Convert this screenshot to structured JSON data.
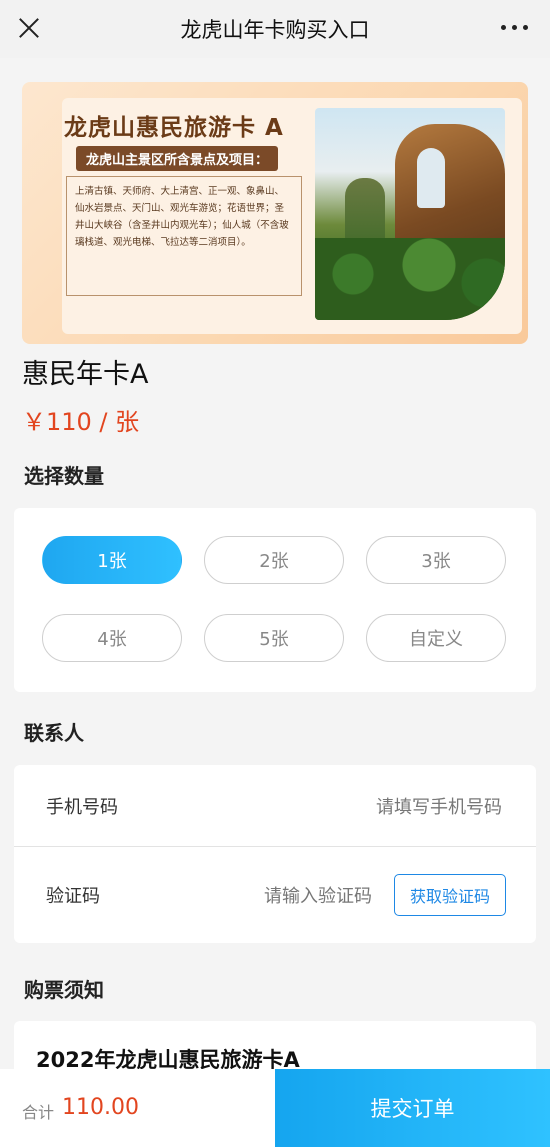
{
  "nav": {
    "title": "龙虎山年卡购买入口"
  },
  "banner": {
    "title": "龙虎山惠民旅游卡 A",
    "subtitle": "龙虎山主景区所含景点及项目：",
    "description": "上清古镇、天师府、大上清宫、正一观、象鼻山、仙水岩景点、天门山、观光车游览；花语世界；圣井山大峡谷（含圣井山内观光车）；仙人城（不含玻璃栈道、观光电梯、飞拉达等二消项目）。"
  },
  "product": {
    "name": "惠民年卡A",
    "price": "￥110 / 张"
  },
  "quantity": {
    "section_title": "选择数量",
    "options": [
      "1张",
      "2张",
      "3张",
      "4张",
      "5张",
      "自定义"
    ],
    "selected_index": 0
  },
  "contact": {
    "section_title": "联系人",
    "phone_label": "手机号码",
    "phone_placeholder": "请填写手机号码",
    "code_label": "验证码",
    "code_placeholder": "请输入验证码",
    "get_code_label": "获取验证码"
  },
  "notice": {
    "section_title": "购票须知",
    "card_title": "2022年龙虎山惠民旅游卡A"
  },
  "footer": {
    "total_label": "合计",
    "total_value": "110.00",
    "submit_label": "提交订单"
  },
  "colors": {
    "accent": "#1fa7f0",
    "price": "#e2451f"
  }
}
